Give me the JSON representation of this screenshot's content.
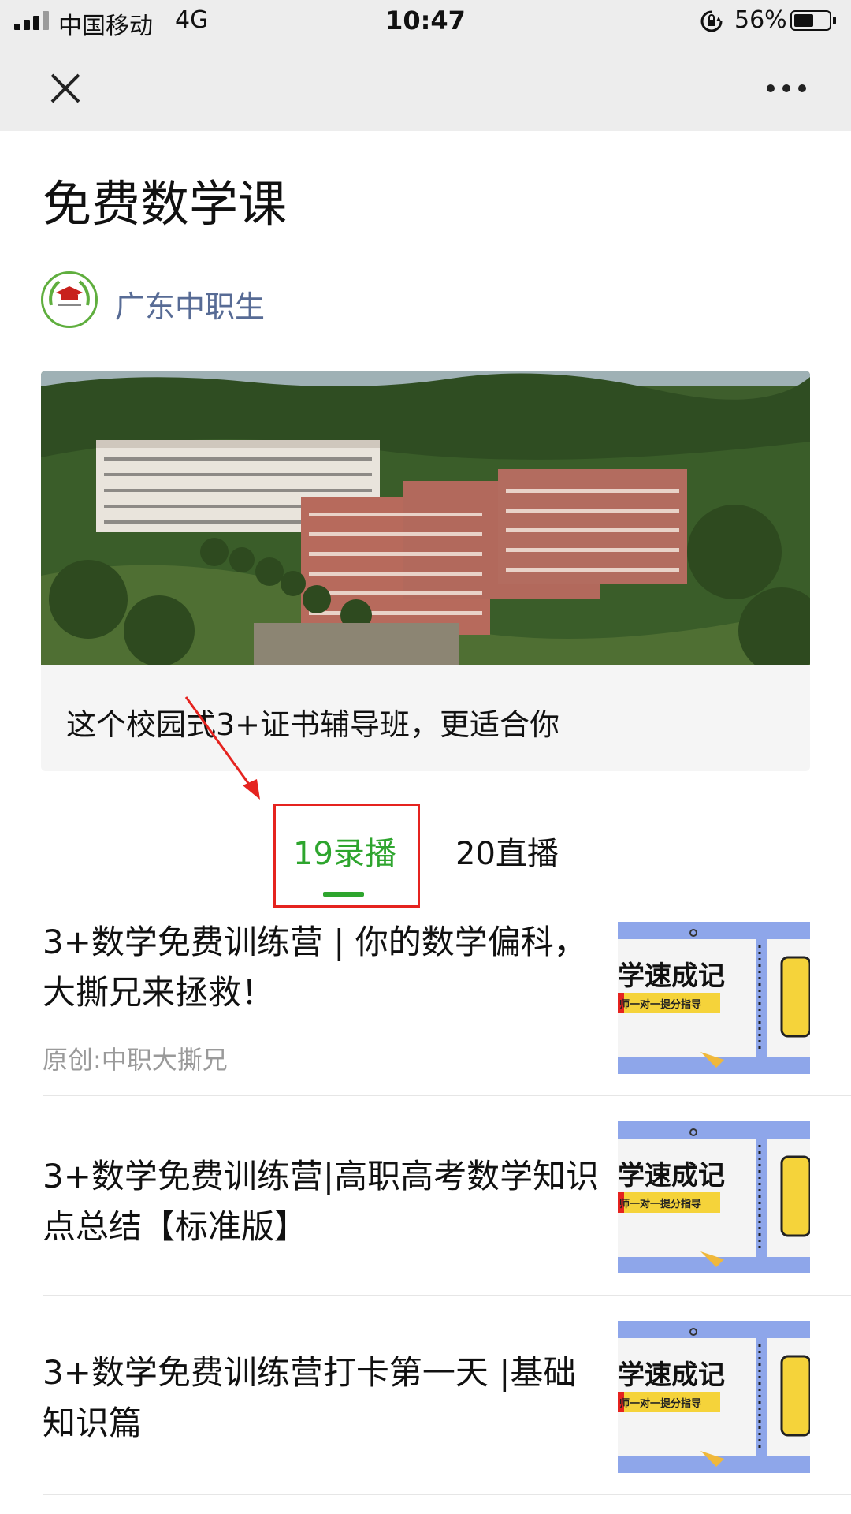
{
  "status_bar": {
    "carrier": "中国移动",
    "network": "4G",
    "time": "10:47",
    "battery_percent": "56%",
    "battery_level": 0.56
  },
  "nav": {
    "close_icon": "close-icon",
    "more_icon": "more-icon"
  },
  "page": {
    "title": "免费数学课",
    "author": "广东中职生"
  },
  "card": {
    "caption": "这个校园式3+证书辅导班，更适合你"
  },
  "tabs": [
    {
      "label": "19录播",
      "active": true
    },
    {
      "label": "20直播",
      "active": false
    }
  ],
  "articles": [
    {
      "title": "3+数学免费训练营 | 你的数学偏科，大撕兄来拯救！",
      "source": "原创:中职大撕兄",
      "thumb_text": "学速成记",
      "thumb_subtext": "师一对一提分指导"
    },
    {
      "title": "3+数学免费训练营|高职高考数学知识点总结【标准版】",
      "source": "",
      "thumb_text": "学速成记",
      "thumb_subtext": "师一对一提分指导"
    },
    {
      "title": "3+数学免费训练营打卡第一天 |基础知识篇",
      "source": "",
      "thumb_text": "学速成记",
      "thumb_subtext": "师一对一提分指导"
    }
  ],
  "colors": {
    "accent_green": "#2ea52e",
    "link_blue": "#576b95",
    "highlight_red": "#e5231f",
    "thumb_blue": "#8ea6ea",
    "thumb_yellow": "#f5d33a"
  }
}
